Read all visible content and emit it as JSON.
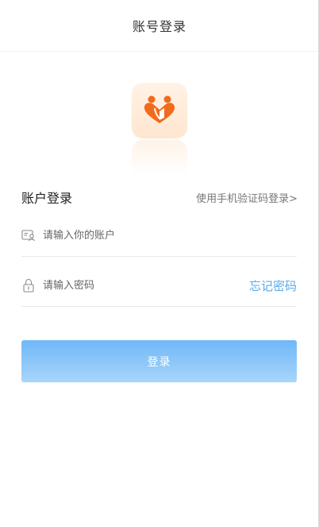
{
  "header": {
    "title": "账号登录"
  },
  "login": {
    "section_title": "账户登录",
    "sms_link": "使用手机验证码登录>",
    "account_placeholder": "请输入你的账户",
    "account_value": "",
    "password_placeholder": "请输入密码",
    "password_value": "",
    "forgot_label": "忘记密码",
    "submit_label": "登录"
  },
  "icons": {
    "logo": "app-logo-hearts-icon",
    "account": "id-card-icon",
    "password": "lock-icon"
  },
  "colors": {
    "accent": "#5aaae8",
    "button_top": "#6fb8f7",
    "button_bottom": "#a9d5fa",
    "logo_orange": "#f26a1b",
    "logo_background": "#fff0e2"
  }
}
